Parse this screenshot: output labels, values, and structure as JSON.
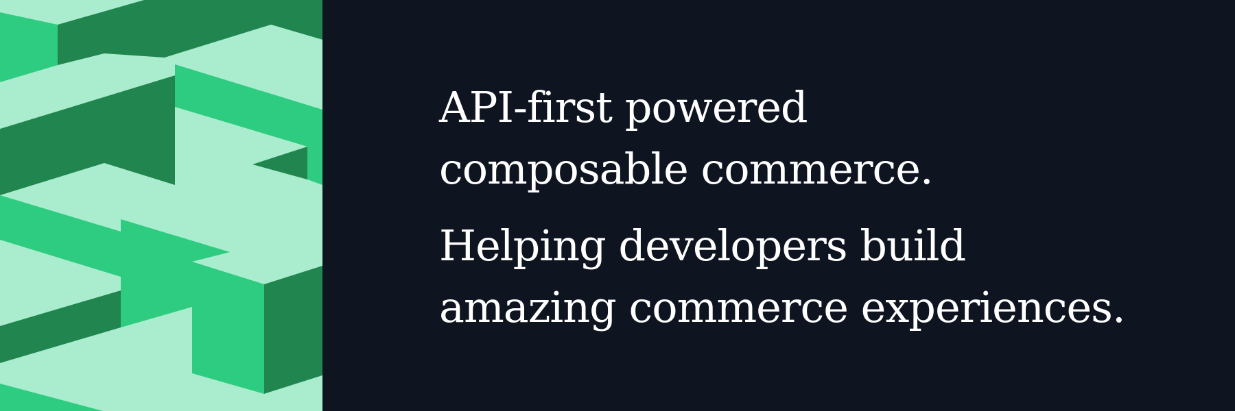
{
  "banner": {
    "colors": {
      "background": "#0e1420",
      "mint": "#a9ecce",
      "green": "#2ecc80",
      "dark_green": "#21854f",
      "text": "#ffffff"
    },
    "headline_1": {
      "line_1": "API-first powered",
      "line_2": "composable commerce."
    },
    "headline_2": {
      "line_1": "Helping developers build",
      "line_2": "amazing commerce experiences."
    }
  }
}
